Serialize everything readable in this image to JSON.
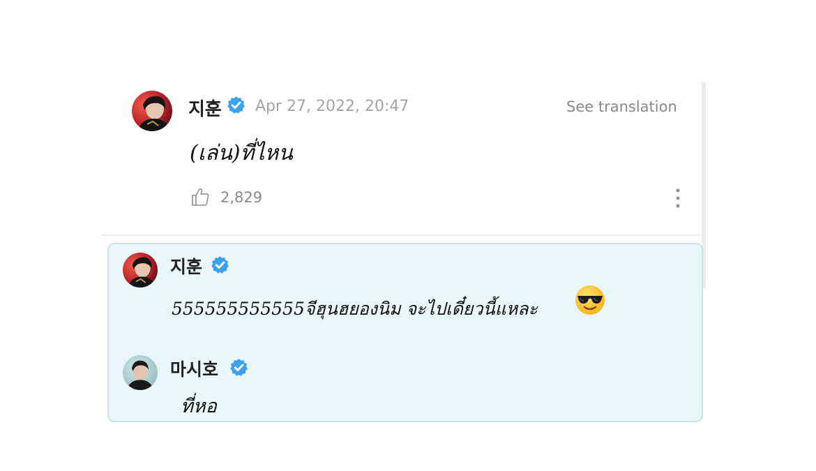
{
  "comment": {
    "author": "지훈",
    "timestamp": "Apr 27, 2022, 20:47",
    "translate_label": "See translation",
    "text": "(เล่น)ที่ไหน",
    "likes": "2,829",
    "avatar_icon": "avatar",
    "like_icon": "thumbs-up-icon",
    "more_icon": "more-vertical-icon"
  },
  "replies": [
    {
      "author": "지훈",
      "text": "555555555555จีฮุนฮยองนิม จะไปเดี๋ยวนี้แหละ",
      "emoji": "smiling-face-with-sunglasses"
    },
    {
      "author": "마시호",
      "text": "ที่หอ"
    }
  ],
  "colors": {
    "verified": "#3ea0f0",
    "reply_background": "#e9f6fb",
    "reply_border": "#c8e3ec",
    "timestamp": "#a3a3a3"
  }
}
